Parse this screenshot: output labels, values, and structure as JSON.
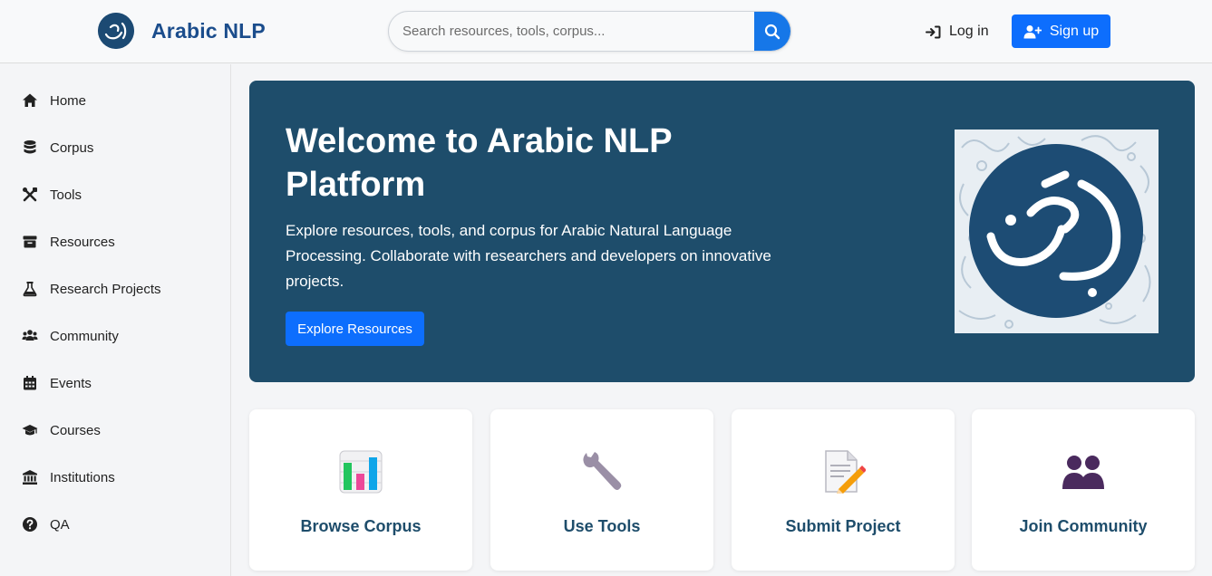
{
  "header": {
    "brand": "Arabic NLP",
    "search_placeholder": "Search resources, tools, corpus...",
    "login_label": "Log in",
    "signup_label": "Sign up"
  },
  "sidebar": {
    "items": [
      {
        "label": "Home",
        "icon": "home-icon"
      },
      {
        "label": "Corpus",
        "icon": "database-icon"
      },
      {
        "label": "Tools",
        "icon": "tools-icon"
      },
      {
        "label": "Resources",
        "icon": "archive-icon"
      },
      {
        "label": "Research Projects",
        "icon": "flask-icon"
      },
      {
        "label": "Community",
        "icon": "users-icon"
      },
      {
        "label": "Events",
        "icon": "calendar-icon"
      },
      {
        "label": "Courses",
        "icon": "graduation-cap-icon"
      },
      {
        "label": "Institutions",
        "icon": "bank-icon"
      },
      {
        "label": "QA",
        "icon": "question-circle-icon"
      }
    ]
  },
  "hero": {
    "title": "Welcome to Arabic NLP Platform",
    "description": "Explore resources, tools, and corpus for Arabic Natural Language Processing. Collaborate with researchers and developers on innovative projects.",
    "button_label": "Explore Resources"
  },
  "cards": [
    {
      "label": "Browse Corpus",
      "icon": "bar-chart-icon"
    },
    {
      "label": "Use Tools",
      "icon": "wrench-icon"
    },
    {
      "label": "Submit Project",
      "icon": "memo-pencil-icon"
    },
    {
      "label": "Join Community",
      "icon": "people-icon"
    }
  ],
  "colors": {
    "brand_blue": "#1b4d8c",
    "primary": "#0d6efd",
    "hero_bg": "#1e4d6b",
    "card_text": "#1e4d6b"
  }
}
